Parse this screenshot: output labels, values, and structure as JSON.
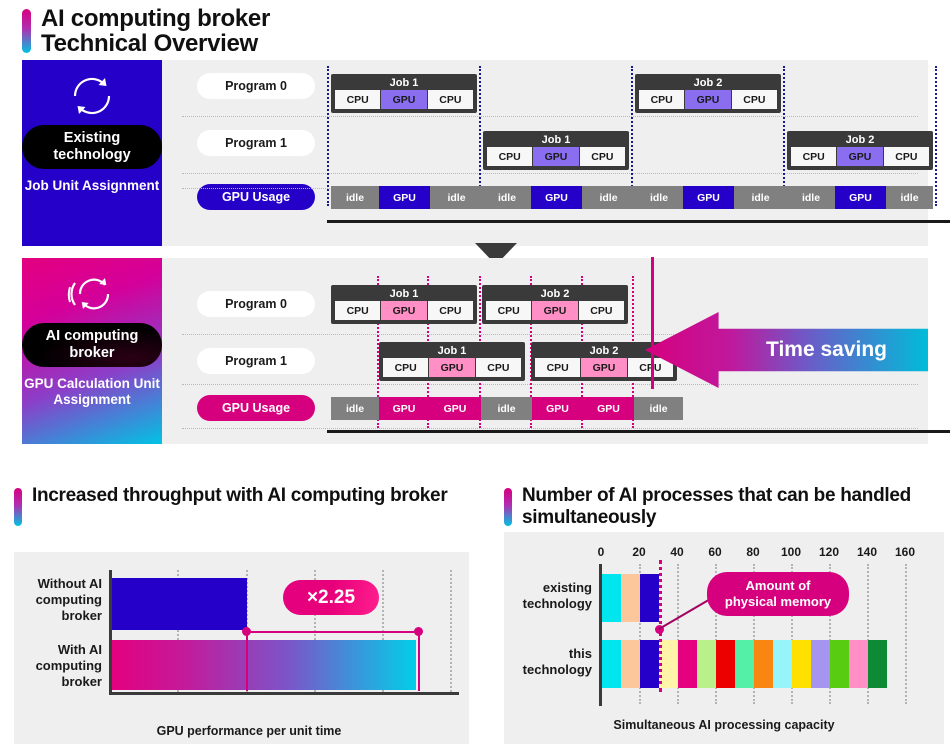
{
  "header": {
    "title_line1": "AI computing broker",
    "title_line2": "Technical Overview"
  },
  "panels": [
    {
      "key": "existing",
      "side": {
        "icon": "circular-arrows-icon",
        "pill": "Existing technology",
        "subtitle": "Job Unit Assignment"
      },
      "rows": [
        {
          "label": "Program 0"
        },
        {
          "label": "Program 1"
        },
        {
          "label": "GPU Usage"
        }
      ],
      "jobs_program0": [
        {
          "name": "Job 1",
          "segments": [
            "CPU",
            "GPU",
            "CPU"
          ]
        },
        {
          "name": "Job 2",
          "segments": [
            "CPU",
            "GPU",
            "CPU"
          ]
        }
      ],
      "jobs_program1": [
        {
          "name": "Job 1",
          "segments": [
            "CPU",
            "GPU",
            "CPU"
          ]
        },
        {
          "name": "Job 2",
          "segments": [
            "CPU",
            "GPU",
            "CPU"
          ]
        }
      ],
      "usage": [
        "idle",
        "GPU",
        "idle",
        "idle",
        "GPU",
        "idle",
        "idle",
        "GPU",
        "idle",
        "idle",
        "GPU",
        "idle"
      ]
    },
    {
      "key": "broker",
      "side": {
        "icon": "multi-circular-arrows-icon",
        "pill": "AI computing broker",
        "subtitle": "GPU Calculation Unit Assignment"
      },
      "rows": [
        {
          "label": "Program 0"
        },
        {
          "label": "Program 1"
        },
        {
          "label": "GPU Usage"
        }
      ],
      "jobs_program0": [
        {
          "name": "Job 1",
          "segments": [
            "CPU",
            "GPU",
            "CPU"
          ]
        },
        {
          "name": "Job 2",
          "segments": [
            "CPU",
            "GPU",
            "CPU"
          ]
        }
      ],
      "jobs_program1": [
        {
          "name": "Job 1",
          "segments": [
            "CPU",
            "GPU",
            "CPU"
          ]
        },
        {
          "name": "Job 2",
          "segments": [
            "CPU",
            "GPU",
            "CPU"
          ]
        }
      ],
      "usage": [
        "idle",
        "GPU",
        "GPU",
        "idle",
        "GPU",
        "GPU",
        "idle"
      ],
      "callout": "Time saving"
    }
  ],
  "chart_throughput": {
    "title": "Increased throughput with AI computing broker",
    "caption": "GPU performance per unit time",
    "ratio_badge": "×2.25"
  },
  "chart_processes": {
    "title": "Number of AI processes that can be handled simultaneously",
    "caption": "Simultaneous AI processing capacity",
    "memory_callout_line1": "Amount of",
    "memory_callout_line2": "physical memory"
  },
  "chart_data": [
    {
      "type": "bar",
      "orientation": "horizontal",
      "title": "Increased throughput with AI computing broker",
      "xlabel": "GPU performance per unit time",
      "ylabel": "",
      "categories": [
        "Without AI computing broker",
        "With AI computing broker"
      ],
      "values": [
        1.0,
        2.25
      ],
      "xlim": [
        0,
        2.8
      ],
      "grid": true,
      "annotations": [
        "×2.25"
      ],
      "colors": [
        "#2400c8",
        "gradient:#e4007f→#00cfe8"
      ]
    },
    {
      "type": "bar",
      "orientation": "horizontal",
      "stacked": true,
      "title": "Number of AI processes that can be handled simultaneously",
      "xlabel": "Simultaneous AI processing capacity",
      "ylabel": "",
      "categories": [
        "existing technology",
        "this technology"
      ],
      "xticks": [
        0,
        20,
        40,
        60,
        80,
        100,
        120,
        140,
        160
      ],
      "xlim": [
        0,
        170
      ],
      "grid": true,
      "series": [
        {
          "name": "existing technology",
          "total": 30,
          "segment_widths": [
            10,
            10,
            10
          ]
        },
        {
          "name": "this technology",
          "total": 150,
          "segment_widths": [
            10,
            10,
            10,
            10,
            10,
            10,
            10,
            10,
            10,
            10,
            10,
            10,
            10,
            10,
            10
          ]
        }
      ],
      "segment_colors": [
        "#00e5ee",
        "#fcc89b",
        "#2400c8",
        "#fff4a8",
        "#e4007f",
        "#b9f08a",
        "#ec0000",
        "#55f0a8",
        "#f88610",
        "#97f4fb",
        "#ffe000",
        "#a595f0",
        "#58cc10",
        "#ff8fc4",
        "#0d8a33"
      ],
      "memory_limit": 30,
      "annotations": [
        "Amount of physical memory"
      ]
    }
  ]
}
